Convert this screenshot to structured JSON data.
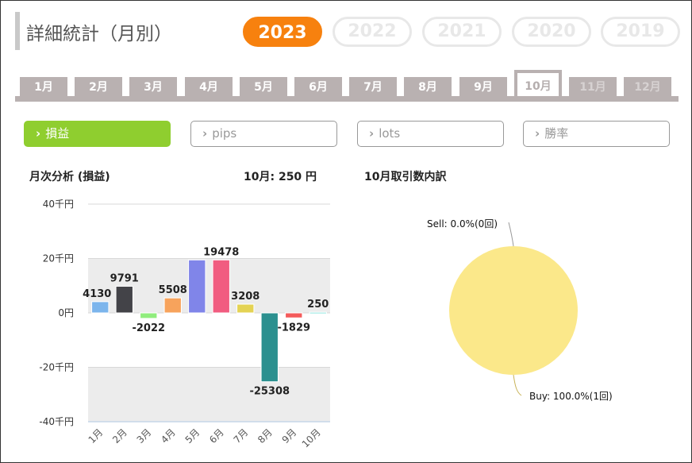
{
  "page": {
    "title": "詳細統計（月別）"
  },
  "years": [
    {
      "label": "2023",
      "active": true
    },
    {
      "label": "2022",
      "active": false
    },
    {
      "label": "2021",
      "active": false
    },
    {
      "label": "2020",
      "active": false
    },
    {
      "label": "2019",
      "active": false
    }
  ],
  "months": [
    "1月",
    "2月",
    "3月",
    "4月",
    "5月",
    "6月",
    "7月",
    "8月",
    "9月",
    "10月",
    "11月",
    "12月"
  ],
  "active_month_index": 9,
  "categories": [
    {
      "label": "損益",
      "active": true
    },
    {
      "label": "pips",
      "active": false
    },
    {
      "label": "lots",
      "active": false
    },
    {
      "label": "勝率",
      "active": false
    }
  ],
  "left_panel": {
    "title": "月次分析 (損益)",
    "month_total": "10月:  250 円"
  },
  "right_panel": {
    "title": "10月取引数内訳"
  },
  "chart_data": [
    {
      "type": "bar",
      "title": "月次分析 (損益)",
      "categories": [
        "1月",
        "2月",
        "3月",
        "4月",
        "5月",
        "6月",
        "7月",
        "8月",
        "9月",
        "10月"
      ],
      "values": [
        4130,
        9791,
        -2022,
        5508,
        19478,
        19478,
        3208,
        -25308,
        -1829,
        250
      ],
      "data_labels": [
        "4130",
        "9791",
        "-2022",
        "5508",
        "",
        "19478",
        "3208",
        "-25308",
        "-1829",
        "250"
      ],
      "colors": [
        "#7cb5ec",
        "#434348",
        "#90ed7d",
        "#f7a35c",
        "#8085e9",
        "#f15c80",
        "#e4d354",
        "#2b908f",
        "#f45b5b",
        "#91e8e1"
      ],
      "ytick_labels": [
        "40千円",
        "20千円",
        "0円",
        "-20千円",
        "-40千円"
      ],
      "ylim": [
        -40000,
        40000
      ],
      "grid": true
    },
    {
      "type": "pie",
      "title": "10月取引数内訳",
      "slices": [
        {
          "name": "Sell",
          "value": 0,
          "label": "Sell: 0.0%(0回)",
          "color": "#f15c80"
        },
        {
          "name": "Buy",
          "value": 1,
          "label": "Buy: 100.0%(1回)",
          "color": "#fbe88a"
        }
      ]
    }
  ]
}
